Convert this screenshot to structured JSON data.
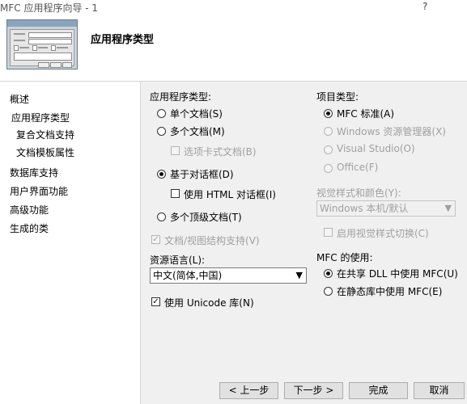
{
  "window": {
    "title": "MFC 应用程序向导 - 1",
    "help_label": "?"
  },
  "header": {
    "title": "应用程序类型"
  },
  "nav": {
    "items": [
      {
        "label": "概述"
      },
      {
        "label": "应用程序类型"
      },
      {
        "label": "复合文档支持"
      },
      {
        "label": "文档模板属性"
      },
      {
        "label": "数据库支持"
      },
      {
        "label": "用户界面功能"
      },
      {
        "label": "高级功能"
      },
      {
        "label": "生成的类"
      }
    ]
  },
  "app_type": {
    "label": "应用程序类型:",
    "options": [
      {
        "label": "单个文档(S)",
        "selected": false
      },
      {
        "label": "多个文档(M)",
        "selected": false
      },
      {
        "label": "基于对话框(D)",
        "selected": true
      },
      {
        "label": "多个顶级文档(T)",
        "selected": false
      }
    ],
    "tabbed_docs": {
      "label": "选项卡式文档(B)",
      "checked": false,
      "enabled": false
    },
    "html_dialog": {
      "label": "使用 HTML 对话框(I)",
      "checked": false
    },
    "doc_view": {
      "label": "文档/视图结构支持(V)",
      "checked": true,
      "enabled": false
    }
  },
  "resource_language": {
    "label": "资源语言(L):",
    "value": "中文(简体,中国)"
  },
  "unicode": {
    "label": "使用 Unicode 库(N)",
    "checked": true
  },
  "project_type": {
    "label": "项目类型:",
    "options": [
      {
        "label": "MFC 标准(A)",
        "selected": true,
        "enabled": true
      },
      {
        "label": "Windows 资源管理器(X)",
        "selected": false,
        "enabled": false
      },
      {
        "label": "Visual Studio(O)",
        "selected": false,
        "enabled": false
      },
      {
        "label": "Office(F)",
        "selected": false,
        "enabled": false
      }
    ]
  },
  "visual_style": {
    "label": "视觉样式和颜色(Y):",
    "value": "Windows 本机/默认",
    "switch_label": "启用视觉样式切换(C)"
  },
  "mfc_use": {
    "label": "MFC 的使用:",
    "options": [
      {
        "label": "在共享 DLL 中使用 MFC(U)",
        "selected": true
      },
      {
        "label": "在静态库中使用 MFC(E)",
        "selected": false
      }
    ]
  },
  "buttons": {
    "prev": "< 上一步",
    "next": "下一步 >",
    "finish": "完成",
    "cancel": "取消"
  },
  "icons": {
    "dropdown": "chevron-down-icon",
    "check": "checkmark-icon"
  }
}
